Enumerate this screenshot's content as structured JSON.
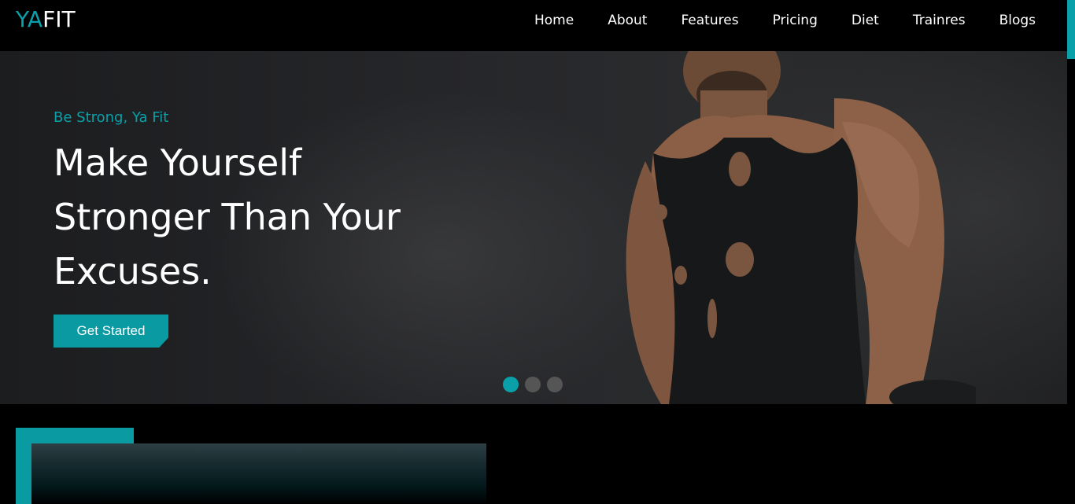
{
  "brand": {
    "part1": "YA",
    "part2": "FIT"
  },
  "nav": {
    "items": [
      {
        "label": "Home"
      },
      {
        "label": "About"
      },
      {
        "label": "Features"
      },
      {
        "label": "Pricing"
      },
      {
        "label": "Diet"
      },
      {
        "label": "Trainres"
      },
      {
        "label": "Blogs"
      }
    ]
  },
  "hero": {
    "tagline": "Be Strong, Ya Fit",
    "title_line1": "Make Yourself",
    "title_line2": "Stronger Than Your",
    "title_line3": "Excuses.",
    "cta_label": "Get Started",
    "slides": {
      "count": 3,
      "active": 1
    }
  },
  "colors": {
    "accent": "#0aa0aa",
    "background": "#000000",
    "text": "#ffffff"
  },
  "icons": [
    "hero-athlete-image",
    "slide-indicator-dot"
  ]
}
